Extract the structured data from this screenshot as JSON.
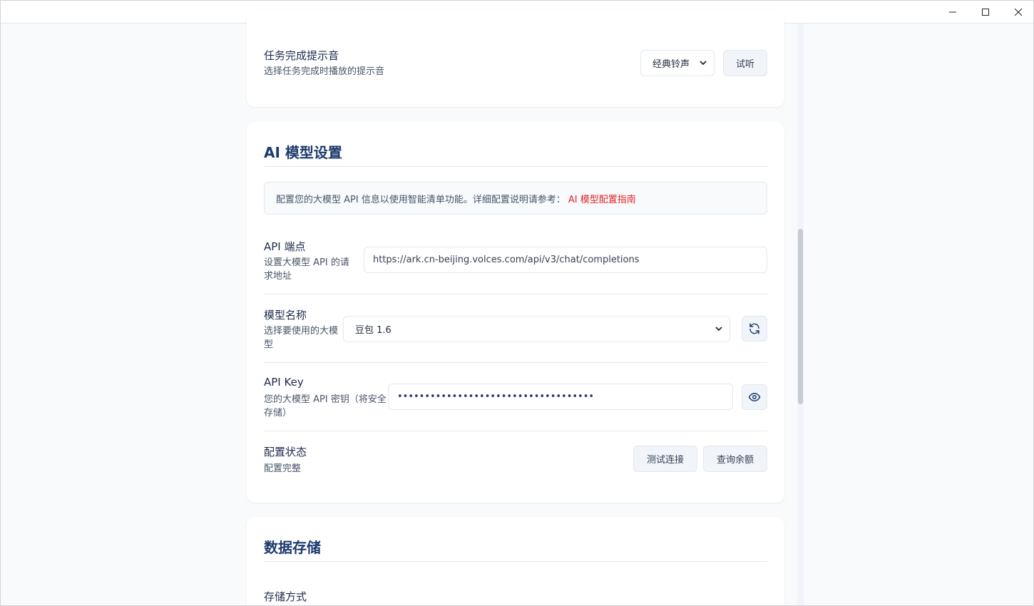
{
  "window": {
    "controls": {
      "minimize": "minimize-icon",
      "maximize": "maximize-icon",
      "close": "close-icon"
    }
  },
  "notification": {
    "title": "任务完成提示音",
    "desc": "选择任务完成时播放的提示音",
    "sound_value": "经典铃声",
    "preview_label": "试听"
  },
  "ai": {
    "section_title": "AI 模型设置",
    "info_text": "配置您的大模型 API 信息以使用智能清单功能。详细配置说明请参考：",
    "info_link": "AI 模型配置指南",
    "endpoint": {
      "title": "API 端点",
      "desc": "设置大模型 API 的请求地址",
      "value": "https://ark.cn-beijing.volces.com/api/v3/chat/completions"
    },
    "model": {
      "title": "模型名称",
      "desc": "选择要使用的大模型",
      "value": "豆包 1.6"
    },
    "key": {
      "title": "API Key",
      "desc": "您的大模型 API 密钥（将安全存储）",
      "value": "••••••••••••••••••••••••••••••••••••"
    },
    "status": {
      "title": "配置状态",
      "desc": "配置完整",
      "test_label": "测试连接",
      "balance_label": "查询余额"
    }
  },
  "storage": {
    "section_title": "数据存储",
    "method_title": "存储方式"
  },
  "colors": {
    "accent_title": "#1e3a6e",
    "link": "#dc2626",
    "card": "#ffffff",
    "background": "#f8fafc"
  }
}
